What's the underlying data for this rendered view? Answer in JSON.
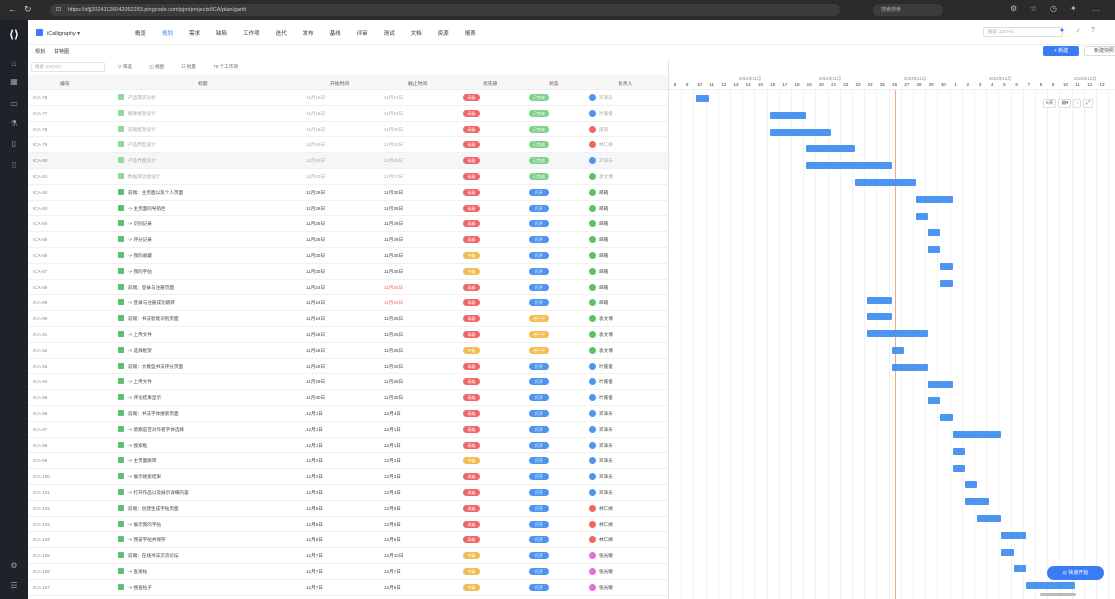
{
  "browser": {
    "url": "https://xfjj20241126042052283.pingcode.com/pjm/projects/ICA/plan/gantt",
    "search_placeholder": "搜索搜索"
  },
  "project": {
    "name": "iCalligraphy"
  },
  "main_tabs": [
    "概览",
    "规划",
    "需求",
    "缺陷",
    "工作项",
    "迭代",
    "发布",
    "基线",
    "评审",
    "测试",
    "文档",
    "资源",
    "报表"
  ],
  "active_tab": "规划",
  "top_search_placeholder": "搜索 (Ctrl+K)",
  "subtabs": [
    "规划",
    "甘特图"
  ],
  "buttons": {
    "new": "+ 新建",
    "quick": "新建快照",
    "quickstart": "快速开始"
  },
  "toolbar": {
    "search_placeholder": "搜索 (Ctrl+K)",
    "filter": "筛选",
    "view": "视图",
    "bulk": "批量",
    "count": "76 个工作项"
  },
  "columns": {
    "id": "编号",
    "title": "标题",
    "start": "开始时间",
    "end": "截止时间",
    "priority": "优先级",
    "status": "状态",
    "owner": "负责人"
  },
  "colors": {
    "accent": "#3b7cf6",
    "bar": "#4c95f0",
    "pri_high": "#f06565",
    "pri_mid": "#f2bd4e",
    "status_done": "#7ed18c",
    "status_open": "#4c95f0",
    "status_progress": "#f2bd4e"
  },
  "rows": [
    {
      "id": "ICA-76",
      "title": "产品需求分析",
      "start": "11月10日",
      "end": "11月10日",
      "priority": "高级",
      "pri": "high",
      "status": "已完成",
      "st": "done",
      "owner": "邓泽乐",
      "av": "#4c95f0",
      "done": true
    },
    {
      "id": "ICA-77",
      "title": "概要框架设计",
      "start": "11月16日",
      "end": "11月18日",
      "priority": "高级",
      "pri": "high",
      "status": "已完成",
      "st": "done",
      "owner": "叶嘉俊",
      "av": "#4c95f0",
      "done": true
    },
    {
      "id": "ICA-78",
      "title": "前端框架设计",
      "start": "11月16日",
      "end": "11月20日",
      "priority": "高级",
      "pri": "high",
      "status": "已完成",
      "st": "done",
      "owner": "邵丽",
      "av": "#f06565",
      "done": true
    },
    {
      "id": "ICA-79",
      "title": "产品原型设计",
      "start": "11月19日",
      "end": "11月22日",
      "priority": "高级",
      "pri": "high",
      "status": "已完成",
      "st": "done",
      "owner": "林仁婧",
      "av": "#f06565",
      "done": true
    },
    {
      "id": "ICA-80",
      "title": "产品界面设计",
      "start": "11月19日",
      "end": "11月25日",
      "priority": "高级",
      "pri": "high",
      "status": "已完成",
      "st": "done",
      "owner": "邓泽乐",
      "av": "#4c95f0",
      "done": true,
      "hl": true
    },
    {
      "id": "ICA-81",
      "title": "数据库功能设计",
      "start": "11月23日",
      "end": "11月27日",
      "priority": "高级",
      "pri": "high",
      "status": "已完成",
      "st": "done",
      "owner": "袁文博",
      "av": "#5bc26a",
      "done": true
    },
    {
      "id": "ICA-82",
      "title": "前端：主页面以及个人页面",
      "start": "11月28日",
      "end": "11月30日",
      "priority": "高级",
      "pri": "high",
      "status": "打开",
      "st": "open",
      "owner": "邮箱",
      "av": "#5bc26a"
    },
    {
      "id": "ICA-83",
      "title": "-> 主页面的导航栏",
      "start": "11月28日",
      "end": "11月28日",
      "priority": "高级",
      "pri": "high",
      "status": "打开",
      "st": "open",
      "owner": "邮箱",
      "av": "#5bc26a"
    },
    {
      "id": "ICA-84",
      "title": "-> 识别记录",
      "start": "11月29日",
      "end": "11月29日",
      "priority": "高级",
      "pri": "high",
      "status": "打开",
      "st": "open",
      "owner": "邮箱",
      "av": "#5bc26a"
    },
    {
      "id": "ICA-85",
      "title": "-> 评分记录",
      "start": "11月29日",
      "end": "11月29日",
      "priority": "高级",
      "pri": "high",
      "status": "打开",
      "st": "open",
      "owner": "邮箱",
      "av": "#5bc26a"
    },
    {
      "id": "ICA-86",
      "title": "-> 我的收藏",
      "start": "11月30日",
      "end": "11月30日",
      "priority": "中级",
      "pri": "mid",
      "status": "打开",
      "st": "open",
      "owner": "邮箱",
      "av": "#5bc26a"
    },
    {
      "id": "ICA-87",
      "title": "-> 我的字帖",
      "start": "11月30日",
      "end": "11月30日",
      "priority": "中级",
      "pri": "mid",
      "status": "打开",
      "st": "open",
      "owner": "邮箱",
      "av": "#5bc26a"
    },
    {
      "id": "ICA-88",
      "title": "前端：登录与注册页面",
      "start": "11月24日",
      "end": "11月25日",
      "priority": "高级",
      "pri": "high",
      "status": "打开",
      "st": "open",
      "owner": "邮箱",
      "av": "#5bc26a",
      "overdue": true
    },
    {
      "id": "ICA-89",
      "title": "-> 登录与注册成功跳转",
      "start": "11月24日",
      "end": "11月25日",
      "priority": "高级",
      "pri": "high",
      "status": "打开",
      "st": "open",
      "owner": "邮箱",
      "av": "#5bc26a",
      "overdue": true
    },
    {
      "id": "ICA-90",
      "title": "前端：书法智能识别页面",
      "start": "11月24日",
      "end": "11月28日",
      "priority": "高级",
      "pri": "high",
      "status": "进行中",
      "st": "progress",
      "owner": "袁文博",
      "av": "#5bc26a"
    },
    {
      "id": "ICA-91",
      "title": "-> 上传文件",
      "start": "11月26日",
      "end": "11月26日",
      "priority": "高级",
      "pri": "high",
      "status": "进行中",
      "st": "progress",
      "owner": "袁文博",
      "av": "#5bc26a"
    },
    {
      "id": "ICA-92",
      "title": "-> 选择框架",
      "start": "11月26日",
      "end": "11月28日",
      "priority": "中级",
      "pri": "mid",
      "status": "进行中",
      "st": "progress",
      "owner": "袁文博",
      "av": "#5bc26a"
    },
    {
      "id": "ICA-93",
      "title": "前端：大模型书法评分页面",
      "start": "11月29日",
      "end": "11月30日",
      "priority": "高级",
      "pri": "high",
      "status": "打开",
      "st": "open",
      "owner": "叶嘉俊",
      "av": "#4c95f0"
    },
    {
      "id": "ICA-94",
      "title": "-> 上传文件",
      "start": "11月29日",
      "end": "11月29日",
      "priority": "高级",
      "pri": "high",
      "status": "打开",
      "st": "open",
      "owner": "叶嘉俊",
      "av": "#4c95f0"
    },
    {
      "id": "ICA-95",
      "title": "-> 评论结果显示",
      "start": "11月30日",
      "end": "11月30日",
      "priority": "高级",
      "pri": "high",
      "status": "打开",
      "st": "open",
      "owner": "叶嘉俊",
      "av": "#4c95f0"
    },
    {
      "id": "ICA-96",
      "title": "前端：书法字体搜索页面",
      "start": "12月1日",
      "end": "12月4日",
      "priority": "高级",
      "pri": "high",
      "status": "打开",
      "st": "open",
      "owner": "邓泽乐",
      "av": "#4c95f0"
    },
    {
      "id": "ICA-97",
      "title": "-> 莫察是否对作者字体选择",
      "start": "12月1日",
      "end": "12月1日",
      "priority": "高级",
      "pri": "high",
      "status": "打开",
      "st": "open",
      "owner": "邓泽乐",
      "av": "#4c95f0"
    },
    {
      "id": "ICA-98",
      "title": "-> 搜索框",
      "start": "12月1日",
      "end": "12月1日",
      "priority": "高级",
      "pri": "high",
      "status": "打开",
      "st": "open",
      "owner": "邓泽乐",
      "av": "#4c95f0"
    },
    {
      "id": "ICA-99",
      "title": "-> 主页面跳转",
      "start": "12月2日",
      "end": "12月2日",
      "priority": "中级",
      "pri": "mid",
      "status": "打开",
      "st": "open",
      "owner": "邓泽乐",
      "av": "#4c95f0"
    },
    {
      "id": "ICA-100",
      "title": "-> 展示搜索结果",
      "start": "12月2日",
      "end": "12月3日",
      "priority": "高级",
      "pri": "high",
      "status": "打开",
      "st": "open",
      "owner": "邓泽乐",
      "av": "#4c95f0"
    },
    {
      "id": "ICA-101",
      "title": "-> 打开作品以及展示详细内容",
      "start": "12月3日",
      "end": "12月4日",
      "priority": "高级",
      "pri": "high",
      "status": "打开",
      "st": "open",
      "owner": "邓泽乐",
      "av": "#4c95f0"
    },
    {
      "id": "ICA-102",
      "title": "前端：创建生成字帖页面",
      "start": "12月5日",
      "end": "12月6日",
      "priority": "高级",
      "pri": "high",
      "status": "打开",
      "st": "open",
      "owner": "林仁婧",
      "av": "#f06565"
    },
    {
      "id": "ICA-103",
      "title": "-> 展示我的字帖",
      "start": "12月5日",
      "end": "12月5日",
      "priority": "高级",
      "pri": "high",
      "status": "打开",
      "st": "open",
      "owner": "林仁婧",
      "av": "#f06565"
    },
    {
      "id": "ICA-104",
      "title": "-> 预览字帖并保存",
      "start": "12月6日",
      "end": "12月6日",
      "priority": "高级",
      "pri": "high",
      "status": "打开",
      "st": "open",
      "owner": "林仁婧",
      "av": "#f06565"
    },
    {
      "id": "ICA-105",
      "title": "前端：在线书法交流论坛",
      "start": "12月7日",
      "end": "12月10日",
      "priority": "中级",
      "pri": "mid",
      "status": "打开",
      "st": "open",
      "owner": "张光耀",
      "av": "#e86ad6"
    },
    {
      "id": "ICA-106",
      "title": "-> 查发帖",
      "start": "12月7日",
      "end": "12月7日",
      "priority": "中级",
      "pri": "mid",
      "status": "打开",
      "st": "open",
      "owner": "张光耀",
      "av": "#e86ad6"
    },
    {
      "id": "ICA-107",
      "title": "-> 搜查帖子",
      "start": "12月7日",
      "end": "12月8日",
      "priority": "中级",
      "pri": "mid",
      "status": "打开",
      "st": "open",
      "owner": "张光耀",
      "av": "#e86ad6"
    }
  ],
  "gantt": {
    "months": [
      "2024年11月",
      "2024年11月",
      "2024年11月",
      "2024年12月",
      "2024年12月"
    ],
    "days": [
      "8",
      "9",
      "10",
      "11",
      "12",
      "13",
      "14",
      "15",
      "16",
      "17",
      "18",
      "19",
      "20",
      "21",
      "22",
      "23",
      "24",
      "25",
      "26",
      "27",
      "28",
      "29",
      "30",
      "1",
      "2",
      "3",
      "4",
      "5",
      "6",
      "7",
      "8",
      "9",
      "10",
      "11",
      "12",
      "13"
    ],
    "zoom_label": "6天",
    "today_index": 18
  }
}
